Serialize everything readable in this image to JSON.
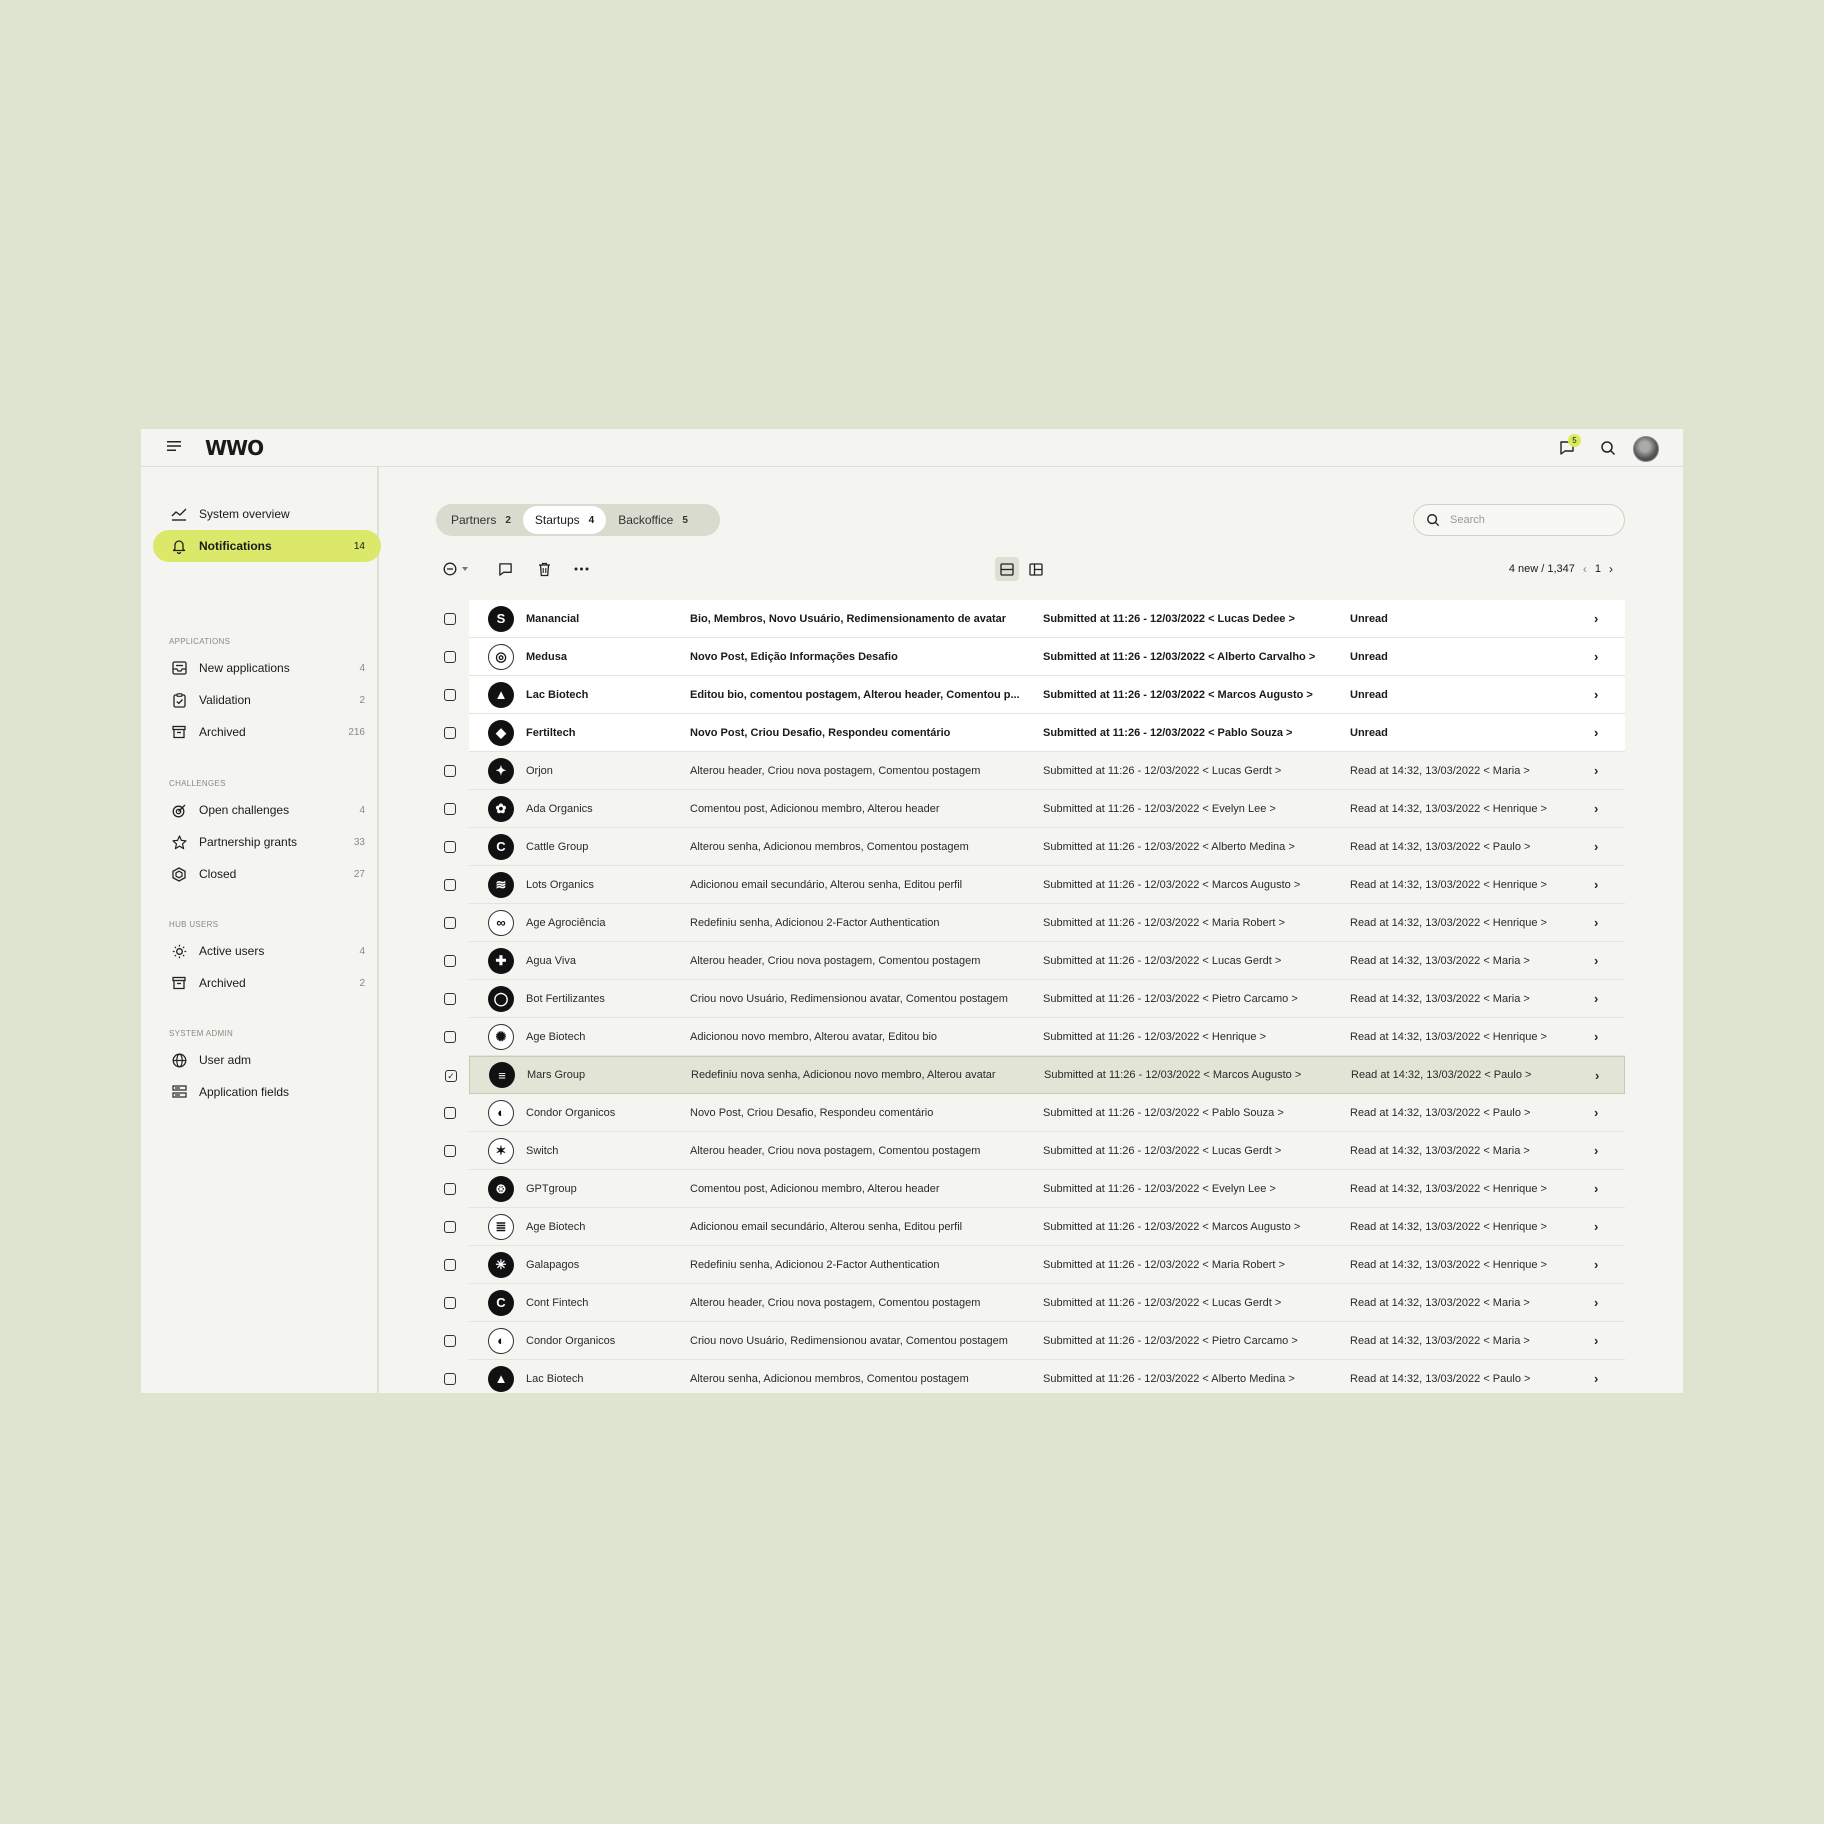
{
  "header": {
    "logo": "WWO",
    "notifications_count": "5"
  },
  "sidebar": {
    "top_items": [
      {
        "label": "System overview",
        "count": ""
      },
      {
        "label": "Notifications",
        "count": "14"
      }
    ],
    "sections": [
      {
        "title": "APPLICATIONS",
        "items": [
          {
            "label": "New applications",
            "count": "4"
          },
          {
            "label": "Validation",
            "count": "2"
          },
          {
            "label": "Archived",
            "count": "216"
          }
        ]
      },
      {
        "title": "CHALLENGES",
        "items": [
          {
            "label": "Open challenges",
            "count": "4"
          },
          {
            "label": "Partnership grants",
            "count": "33"
          },
          {
            "label": "Closed",
            "count": "27"
          }
        ]
      },
      {
        "title": "HUB USERS",
        "items": [
          {
            "label": "Active users",
            "count": "4"
          },
          {
            "label": "Archived",
            "count": "2"
          }
        ]
      },
      {
        "title": "SYSTEM ADMIN",
        "items": [
          {
            "label": "User adm",
            "count": ""
          },
          {
            "label": "Application fields",
            "count": ""
          }
        ]
      }
    ]
  },
  "tabs": [
    {
      "label": "Partners",
      "count": "2"
    },
    {
      "label": "Startups",
      "count": "4"
    },
    {
      "label": "Backoffice",
      "count": "5"
    }
  ],
  "search": {
    "placeholder": "Search"
  },
  "pager": {
    "summary": "4 new / 1,347",
    "page": "1"
  },
  "rows": [
    {
      "name": "Manancial",
      "action": "Bio, Membros, Novo Usuário, Redimensionamento de avatar",
      "submitted": "Submitted at 11:26 - 12/03/2022 < Lucas Dedee >",
      "status": "Unread"
    },
    {
      "name": "Medusa",
      "action": "Novo Post, Edição Informações Desafio",
      "submitted": "Submitted at 11:26 - 12/03/2022 < Alberto Carvalho >",
      "status": "Unread"
    },
    {
      "name": "Lac Biotech",
      "action": "Editou bio, comentou postagem, Alterou header, Comentou p...",
      "submitted": "Submitted at 11:26 - 12/03/2022 < Marcos Augusto >",
      "status": "Unread"
    },
    {
      "name": "Fertiltech",
      "action": "Novo Post, Criou Desafio, Respondeu comentário",
      "submitted": "Submitted at 11:26 - 12/03/2022 < Pablo Souza >",
      "status": "Unread"
    },
    {
      "name": "Orjon",
      "action": "Alterou header, Criou nova postagem, Comentou postagem",
      "submitted": "Submitted at 11:26 - 12/03/2022 < Lucas Gerdt >",
      "status": "Read at 14:32, 13/03/2022 < Maria >"
    },
    {
      "name": "Ada Organics",
      "action": "Comentou post, Adicionou membro, Alterou header",
      "submitted": "Submitted at 11:26 - 12/03/2022 < Evelyn Lee >",
      "status": "Read at 14:32, 13/03/2022 < Henrique >"
    },
    {
      "name": "Cattle Group",
      "action": "Alterou senha, Adicionou membros, Comentou postagem",
      "submitted": "Submitted at 11:26 - 12/03/2022 < Alberto Medina >",
      "status": "Read at 14:32, 13/03/2022 < Paulo >"
    },
    {
      "name": "Lots Organics",
      "action": "Adicionou email secundário, Alterou senha, Editou perfil",
      "submitted": "Submitted at 11:26 - 12/03/2022 < Marcos Augusto >",
      "status": "Read at 14:32, 13/03/2022 < Henrique >"
    },
    {
      "name": "Age Agrociência",
      "action": "Redefiniu senha, Adicionou 2-Factor Authentication",
      "submitted": "Submitted at 11:26 - 12/03/2022 < Maria Robert >",
      "status": "Read at 14:32, 13/03/2022 < Henrique >"
    },
    {
      "name": "Agua Viva",
      "action": "Alterou header, Criou nova postagem, Comentou postagem",
      "submitted": "Submitted at 11:26 - 12/03/2022 < Lucas Gerdt >",
      "status": "Read at 14:32, 13/03/2022 < Maria >"
    },
    {
      "name": "Bot Fertilizantes",
      "action": "Criou novo Usuário, Redimensionou avatar, Comentou postagem",
      "submitted": "Submitted at 11:26 - 12/03/2022 < Pietro Carcamo >",
      "status": "Read at 14:32, 13/03/2022 < Maria >"
    },
    {
      "name": "Age Biotech",
      "action": "Adicionou novo membro, Alterou avatar, Editou bio",
      "submitted": "Submitted at 11:26 - 12/03/2022 < Henrique >",
      "status": "Read at 14:32, 13/03/2022 < Henrique >"
    },
    {
      "name": "Mars Group",
      "action": "Redefiniu nova senha, Adicionou novo membro, Alterou avatar",
      "submitted": "Submitted at 11:26 - 12/03/2022 < Marcos Augusto >",
      "status": "Read at 14:32, 13/03/2022 < Paulo >"
    },
    {
      "name": "Condor Organicos",
      "action": "Novo Post, Criou Desafio, Respondeu comentário",
      "submitted": "Submitted at 11:26 - 12/03/2022 < Pablo Souza >",
      "status": "Read at 14:32, 13/03/2022 < Paulo >"
    },
    {
      "name": "Switch",
      "action": "Alterou header, Criou nova postagem, Comentou postagem",
      "submitted": "Submitted at 11:26 - 12/03/2022 < Lucas Gerdt >",
      "status": "Read at 14:32, 13/03/2022 < Maria >"
    },
    {
      "name": "GPTgroup",
      "action": "Comentou post, Adicionou membro, Alterou header",
      "submitted": "Submitted at 11:26 - 12/03/2022 < Evelyn Lee >",
      "status": "Read at 14:32, 13/03/2022 < Henrique >"
    },
    {
      "name": "Age Biotech",
      "action": "Adicionou email secundário, Alterou senha, Editou perfil",
      "submitted": "Submitted at 11:26 - 12/03/2022 < Marcos Augusto >",
      "status": "Read at 14:32, 13/03/2022 < Henrique >"
    },
    {
      "name": "Galapagos",
      "action": "Redefiniu senha, Adicionou 2-Factor Authentication",
      "submitted": "Submitted at 11:26 - 12/03/2022 < Maria Robert >",
      "status": "Read at 14:32, 13/03/2022 < Henrique >"
    },
    {
      "name": "Cont Fintech",
      "action": "Alterou header, Criou nova postagem, Comentou postagem",
      "submitted": "Submitted at 11:26 - 12/03/2022 < Lucas Gerdt >",
      "status": "Read at 14:32, 13/03/2022 < Maria >"
    },
    {
      "name": "Condor Organicos",
      "action": "Criou novo Usuário, Redimensionou avatar, Comentou postagem",
      "submitted": "Submitted at 11:26 - 12/03/2022 < Pietro Carcamo >",
      "status": "Read at 14:32, 13/03/2022 < Maria >"
    },
    {
      "name": "Lac Biotech",
      "action": "Alterou senha, Adicionou membros, Comentou postagem",
      "submitted": "Submitted at 11:26 - 12/03/2022 < Alberto Medina >",
      "status": "Read at 14:32, 13/03/2022 < Paulo >"
    }
  ]
}
